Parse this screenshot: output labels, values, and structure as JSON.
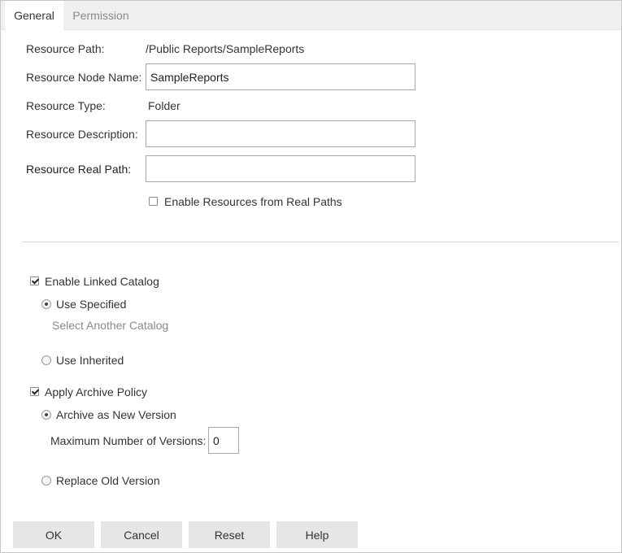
{
  "tabs": {
    "general": "General",
    "permission": "Permission"
  },
  "form": {
    "resource_path_label": "Resource Path:",
    "resource_path_value": "/Public Reports/SampleReports",
    "node_name_label": "Resource Node Name:",
    "node_name_value": "SampleReports",
    "type_label": "Resource Type:",
    "type_value": "Folder",
    "description_label": "Resource Description:",
    "description_value": "",
    "real_path_label": "Resource Real Path:",
    "real_path_value": "",
    "enable_real_paths_label": "Enable Resources from Real Paths",
    "enable_real_paths_checked": false
  },
  "catalog": {
    "enable_label": "Enable Linked Catalog",
    "enable_checked": true,
    "use_specified_label": "Use Specified",
    "use_specified_selected": true,
    "select_another_label": "Select Another Catalog",
    "use_inherited_label": "Use Inherited",
    "use_inherited_selected": false
  },
  "archive": {
    "apply_label": "Apply Archive Policy",
    "apply_checked": true,
    "new_version_label": "Archive as New Version",
    "new_version_selected": true,
    "max_versions_label": "Maximum Number of Versions:",
    "max_versions_value": "0",
    "replace_label": "Replace Old Version",
    "replace_selected": false
  },
  "buttons": {
    "ok": "OK",
    "cancel": "Cancel",
    "reset": "Reset",
    "help": "Help"
  }
}
